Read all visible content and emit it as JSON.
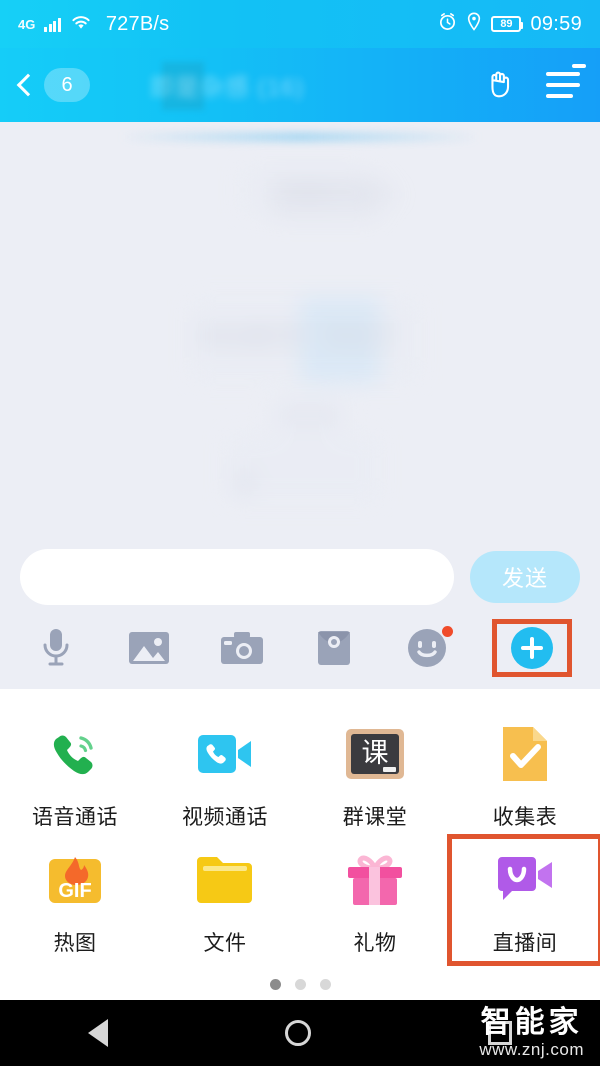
{
  "status_bar": {
    "network_type": "4G",
    "signal_icon": "signal-bars-icon",
    "wifi_icon": "wifi-icon",
    "speed": "727B/s",
    "alarm_icon": "alarm-clock-icon",
    "location_icon": "location-pin-icon",
    "battery_level": "89",
    "time": "09:59"
  },
  "app_bar": {
    "back_icon": "back-chevron-icon",
    "unread_count": "6",
    "title": "即是杂感 (16)",
    "hand_icon": "rock-hand-icon",
    "menu_icon": "hamburger-menu-icon",
    "menu_has_badge": true,
    "background_color": "#14c6f7"
  },
  "chat": {
    "blurred_messages": [
      {
        "text": "已撤回 09:51"
      },
      {
        "text": "本帖置顶！等我下"
      },
      {
        "text": "09:58"
      },
      {
        "text": "我"
      }
    ]
  },
  "input_bar": {
    "input_value": "",
    "input_placeholder": "",
    "send_label": "发送",
    "send_color": "#b5e7fb"
  },
  "toolbar": {
    "items": [
      {
        "name": "voice-record-icon",
        "label": "语音",
        "badge": false
      },
      {
        "name": "gallery-icon",
        "label": "图片",
        "badge": false
      },
      {
        "name": "camera-icon",
        "label": "拍照",
        "badge": false
      },
      {
        "name": "red-envelope-icon",
        "label": "红包",
        "badge": false
      },
      {
        "name": "emoji-icon",
        "label": "表情",
        "badge": true
      },
      {
        "name": "plus-icon",
        "label": "更多",
        "badge": false,
        "highlighted": true
      }
    ],
    "highlight_color": "#e0552f",
    "plus_color": "#22bdf0"
  },
  "panel": {
    "rows": [
      [
        {
          "icon": "voice-call-icon",
          "label": "语音通话",
          "highlighted": false
        },
        {
          "icon": "video-call-icon",
          "label": "视频通话",
          "highlighted": false
        },
        {
          "icon": "classroom-icon",
          "label": "群课堂",
          "highlighted": false
        },
        {
          "icon": "form-icon",
          "label": "收集表",
          "highlighted": false
        }
      ],
      [
        {
          "icon": "gif-icon",
          "label": "热图",
          "highlighted": false
        },
        {
          "icon": "folder-icon",
          "label": "文件",
          "highlighted": false
        },
        {
          "icon": "gift-icon",
          "label": "礼物",
          "highlighted": false
        },
        {
          "icon": "live-room-icon",
          "label": "直播间",
          "highlighted": true
        }
      ]
    ],
    "classroom_glyph": "课",
    "gif_glyph": "GIF",
    "page_dots": {
      "count": 3,
      "active_index": 0
    }
  },
  "nav_bar": {
    "back_icon": "nav-back-triangle-icon",
    "home_icon": "nav-home-circle-icon",
    "recents_icon": "nav-recents-square-icon"
  },
  "watermark": {
    "brand": "智能家",
    "url": "www.znj.com"
  }
}
